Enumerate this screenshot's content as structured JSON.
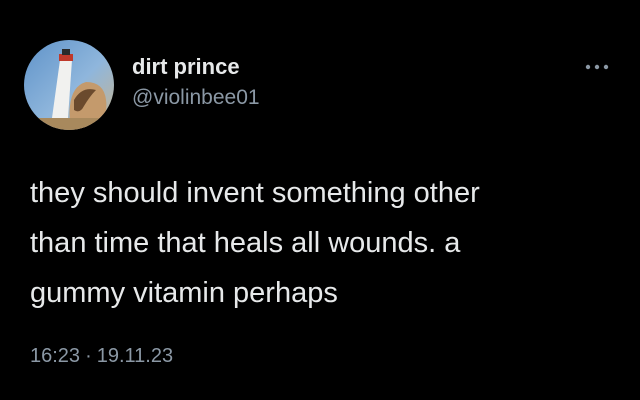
{
  "author": {
    "display_name": "dirt prince",
    "handle": "@violinbee01",
    "avatar_icon": "profile-photo-lighthouse"
  },
  "more_menu_icon": "more-horizontal-icon",
  "tweet": {
    "text_lines": [
      "they should invent something other",
      "than time that heals all wounds. a",
      "gummy vitamin perhaps"
    ],
    "time": "16:23",
    "separator": "·",
    "date": "19.11.23"
  },
  "colors": {
    "background": "#000000",
    "primary_text": "#e7e9ea",
    "secondary_text": "#8b98a5"
  }
}
